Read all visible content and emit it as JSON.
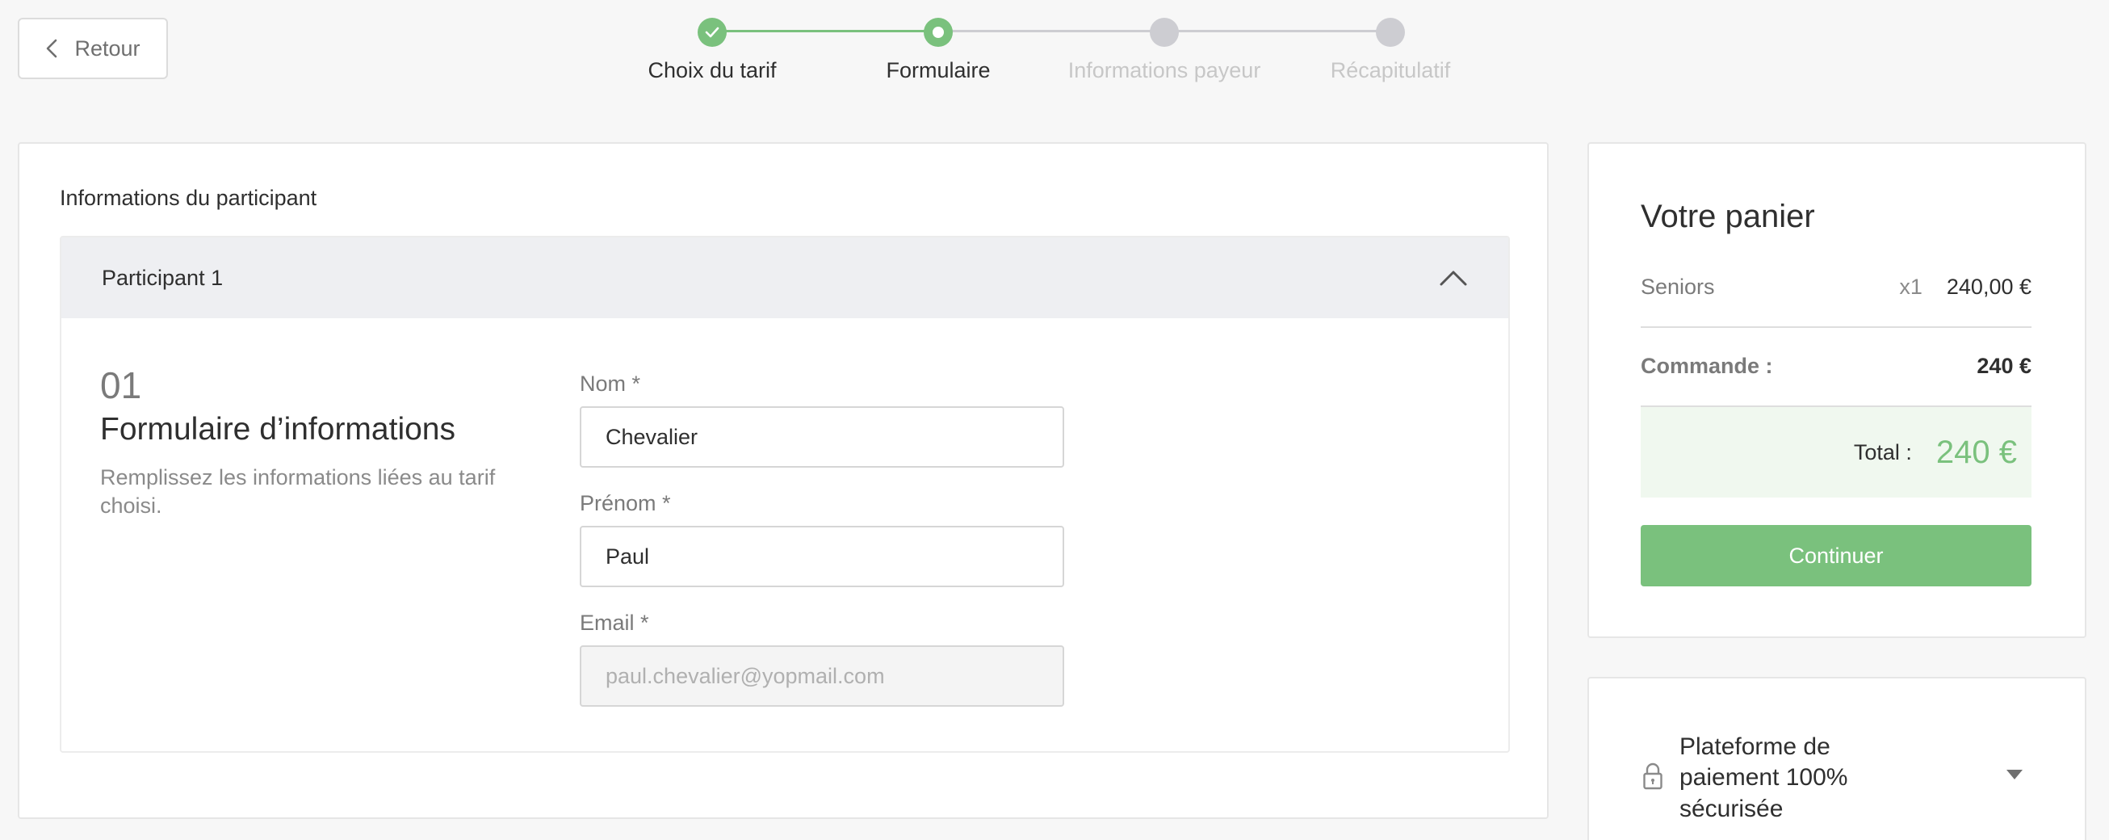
{
  "nav": {
    "back_label": "Retour"
  },
  "stepper": {
    "steps": [
      {
        "label": "Choix du tarif",
        "state": "done"
      },
      {
        "label": "Formulaire",
        "state": "current"
      },
      {
        "label": "Informations payeur",
        "state": "todo"
      },
      {
        "label": "Récapitulatif",
        "state": "todo"
      }
    ]
  },
  "main": {
    "section_title": "Informations du participant",
    "participant": {
      "title": "Participant 1",
      "form_number": "01",
      "form_heading": "Formulaire d’informations",
      "form_description": "Remplissez les informations liées au tarif choisi.",
      "fields": {
        "nom": {
          "label": "Nom *",
          "value": "Chevalier"
        },
        "prenom": {
          "label": "Prénom *",
          "value": "Paul"
        },
        "email": {
          "label": "Email *",
          "value": "paul.chevalier@yopmail.com",
          "disabled": true
        }
      }
    }
  },
  "cart": {
    "title": "Votre panier",
    "items": [
      {
        "name": "Seniors",
        "qty": "x1",
        "price": "240,00 €"
      }
    ],
    "order_label": "Commande :",
    "order_value": "240 €",
    "total_label": "Total :",
    "total_value": "240 €",
    "continue_label": "Continuer"
  },
  "secure": {
    "text": "Plateforme de paiement 100% sécurisée"
  },
  "colors": {
    "accent": "#7ac17d",
    "inactive_step": "#cdcdd2",
    "total_bg": "#f0f8ef"
  },
  "icons": {
    "back": "chevron-left-icon",
    "collapse": "chevron-up-icon",
    "lock": "lock-icon",
    "expand": "caret-down-icon",
    "step_done": "check-icon"
  }
}
